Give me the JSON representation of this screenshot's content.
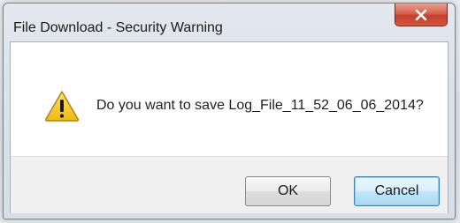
{
  "dialog": {
    "title": "File Download - Security Warning",
    "message": "Do you want to save Log_File_11_52_06_06_2014?",
    "icon": "warning-icon"
  },
  "buttons": {
    "ok_label": "OK",
    "cancel_label": "Cancel"
  },
  "colors": {
    "close_button": "#d2563f",
    "default_button_border": "#3c7fb1",
    "warning_yellow": "#f5c518"
  }
}
